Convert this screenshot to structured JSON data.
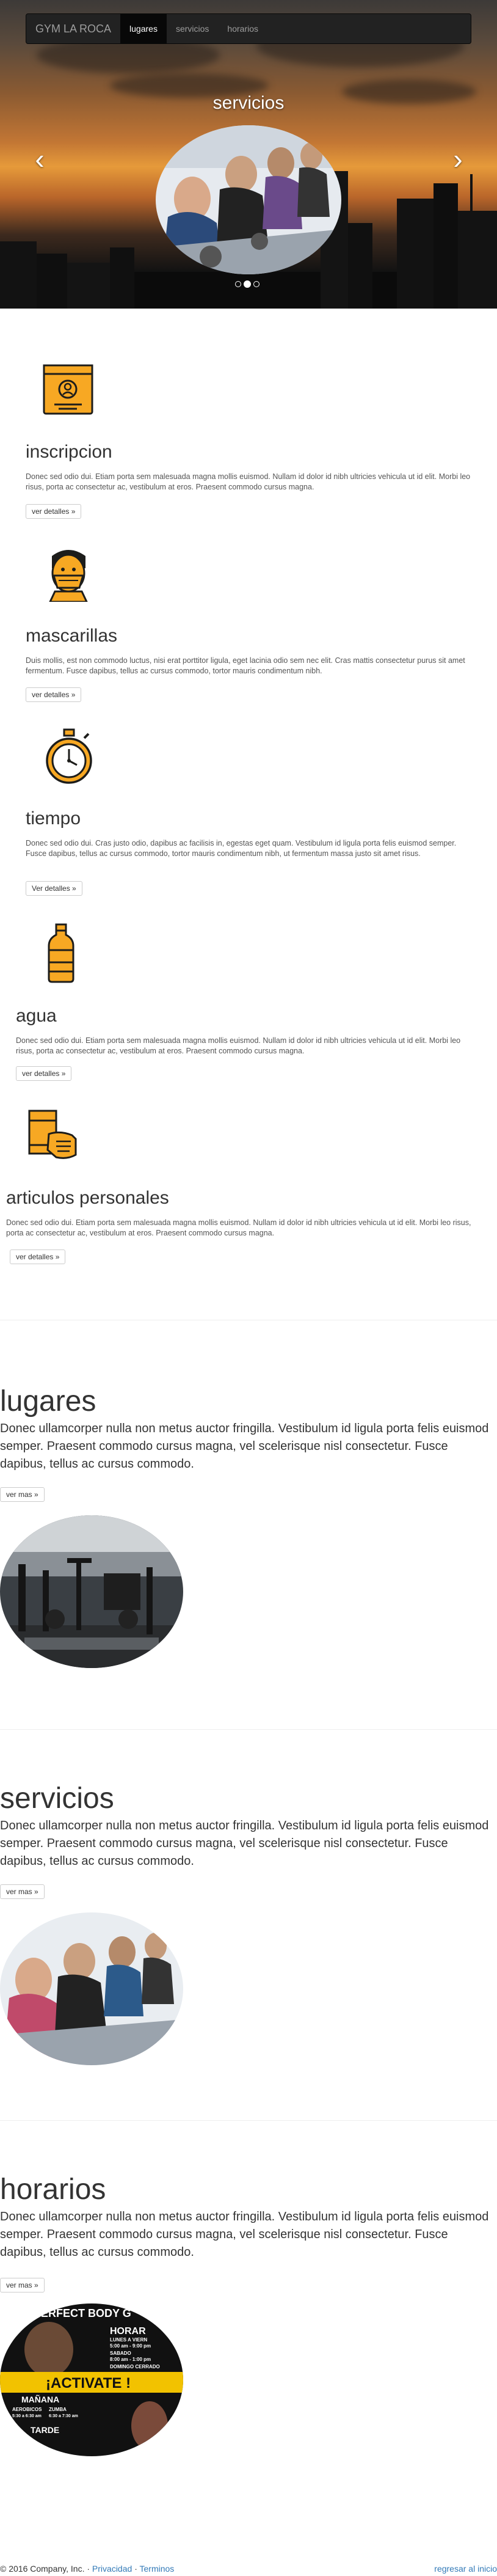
{
  "navbar": {
    "brand": "GYM LA ROCA",
    "links": [
      {
        "label": "lugares",
        "active": true
      },
      {
        "label": "servicios",
        "active": false
      },
      {
        "label": "horarios",
        "active": false
      }
    ]
  },
  "carousel": {
    "caption": "servicios",
    "prev_icon": "chevron-left-icon",
    "next_icon": "chevron-right-icon",
    "slide_count": 3,
    "active_slide": 2
  },
  "features": [
    {
      "icon": "id-card-icon",
      "title": "inscripcion",
      "text": "Donec sed odio dui. Etiam porta sem malesuada magna mollis euismod. Nullam id dolor id nibh ultricies vehicula ut id elit. Morbi leo risus, porta ac consectetur ac, vestibulum at eros. Praesent commodo cursus magna.",
      "button": "ver detalles »"
    },
    {
      "icon": "face-mask-icon",
      "title": "mascarillas",
      "text": "Duis mollis, est non commodo luctus, nisi erat porttitor ligula, eget lacinia odio sem nec elit. Cras mattis consectetur purus sit amet fermentum. Fusce dapibus, tellus ac cursus commodo, tortor mauris condimentum nibh.",
      "button": "ver detalles »"
    },
    {
      "icon": "stopwatch-icon",
      "title": "tiempo",
      "text": "Donec sed odio dui. Cras justo odio, dapibus ac facilisis in, egestas eget quam. Vestibulum id ligula porta felis euismod semper. Fusce dapibus, tellus ac cursus commodo, tortor mauris condimentum nibh, ut fermentum massa justo sit amet risus.",
      "button": "Ver detalles »"
    },
    {
      "icon": "water-bottle-icon",
      "title": "agua",
      "text": "Donec sed odio dui. Etiam porta sem malesuada magna mollis euismod. Nullam id dolor id nibh ultricies vehicula ut id elit. Morbi leo risus, porta ac consectetur ac, vestibulum at eros. Praesent commodo cursus magna.",
      "button": "ver detalles »"
    },
    {
      "icon": "towel-hand-icon",
      "title": "articulos personales",
      "text": "Donec sed odio dui. Etiam porta sem malesuada magna mollis euismod. Nullam id dolor id nibh ultricies vehicula ut id elit. Morbi leo risus, porta ac consectetur ac, vestibulum at eros. Praesent commodo cursus magna.",
      "button": "ver detalles »"
    }
  ],
  "sections": [
    {
      "title": "lugares",
      "text": "Donec ullamcorper nulla non metus auctor fringilla. Vestibulum id ligula porta felis euismod semper. Praesent commodo cursus magna, vel scelerisque nisl consectetur. Fusce dapibus, tellus ac cursus commodo.",
      "button": "ver mas »",
      "image": "gym-equipment-photo"
    },
    {
      "title": "servicios",
      "text": "Donec ullamcorper nulla non metus auctor fringilla. Vestibulum id ligula porta felis euismod semper. Praesent commodo cursus magna, vel scelerisque nisl consectetur. Fusce dapibus, tellus ac cursus commodo.",
      "button": "ver mas »",
      "image": "spinning-class-photo"
    },
    {
      "title": "horarios",
      "text": "Donec ullamcorper nulla non metus auctor fringilla. Vestibulum id ligula porta felis euismod semper. Praesent commodo cursus magna, vel scelerisque nisl consectetur. Fusce dapibus, tellus ac cursus commodo.",
      "button": "ver mas »",
      "image": "schedule-poster-photo"
    }
  ],
  "poster": {
    "top": "PERFECT BODY G",
    "side_title": "HORAR",
    "side_lines": [
      "LUNES A VIERN",
      "5:00 am - 9:00 pm",
      "SABADO",
      "8:00 am - 1:00 pm",
      "DOMINGO CERRADO"
    ],
    "banner": "¡ACTIVATE !",
    "manana": "MAÑANA",
    "tarde": "TARDE",
    "classes": [
      "AEROBICOS",
      "ZUMBA",
      "5:30 a 6:30 am",
      "6:30 a 7:30 am"
    ]
  },
  "footer": {
    "copyright": "© 2016 Company, Inc.",
    "sep": "·",
    "privacy": "Privacidad",
    "terms": "Terminos",
    "back_to_top": "regresar al inicio"
  },
  "colors": {
    "navbar_bg": "#222222",
    "icon_orange": "#f7a823",
    "icon_outline": "#1d1d1b",
    "link": "#337ab7"
  }
}
